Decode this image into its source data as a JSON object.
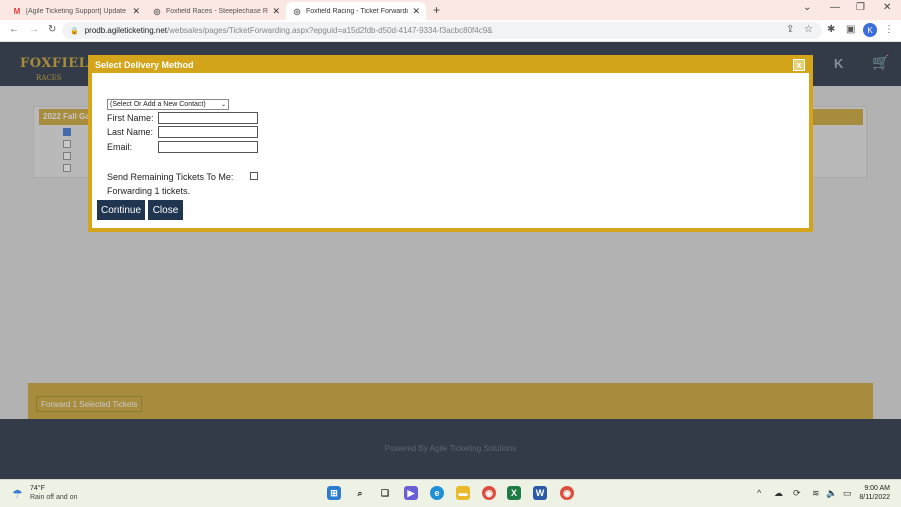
{
  "browser": {
    "tabs": [
      {
        "label": "[Agile Ticketing Support] Update",
        "icon": "gmail-icon"
      },
      {
        "label": "Foxfield Races - Steeplechase Ra",
        "icon": "globe-icon"
      },
      {
        "label": "Foxfield Racing - Ticket Forwardi",
        "icon": "globe-icon"
      }
    ],
    "new_tab": "+",
    "url_host": "prodb.agileticketing.net",
    "url_path": "/websales/pages/TicketForwarding.aspx?epguid=a15d2fdb-d50d-4147-9334-f3acbc80f4c9&",
    "profile_initial": "K"
  },
  "site": {
    "logo": "FOXFIELD",
    "logo_sub": "RACES",
    "header_k": "K",
    "panel_title": "2022 Fall Ga",
    "forward_button": "Forward 1 Selected Tickets",
    "footer_text": "Powered By Agile Ticketing Solutions"
  },
  "modal": {
    "title": "Select Delivery Method",
    "close_glyph": "x",
    "contact_select_value": "(Select Or Add a New Contact)",
    "first_name_label": "First Name:",
    "last_name_label": "Last Name:",
    "email_label": "Email:",
    "first_name_value": "",
    "last_name_value": "",
    "email_value": "",
    "send_remaining_label": "Send Remaining Tickets To Me:",
    "forwarding_text": "Forwarding 1 tickets.",
    "continue_label": "Continue",
    "close_label": "Close"
  },
  "taskbar": {
    "weather_temp": "74°F",
    "weather_desc": "Rain off and on",
    "time": "9:00 AM",
    "date": "8/11/2022"
  },
  "colors": {
    "brand_gold": "#d4a51a",
    "navy": "#19253a",
    "button_navy": "#1f3550"
  }
}
